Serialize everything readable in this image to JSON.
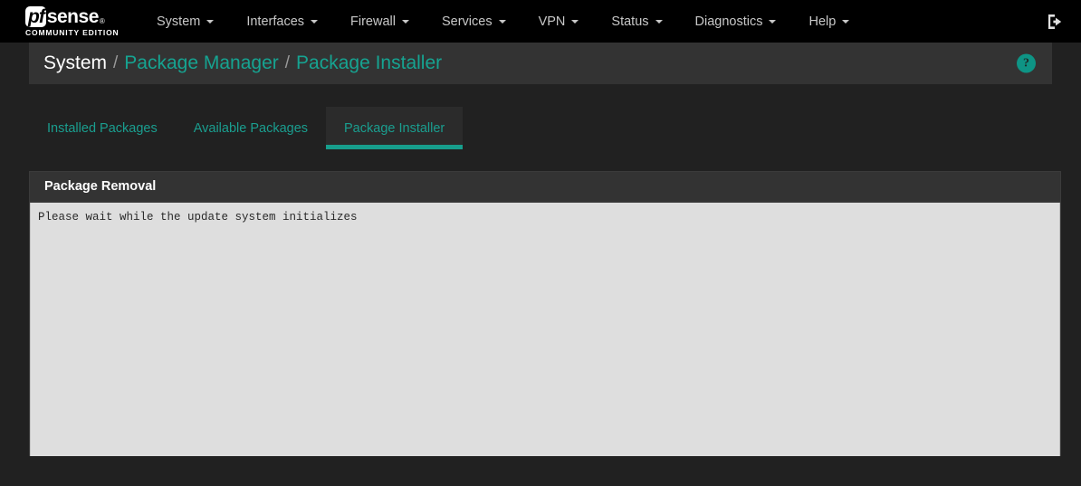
{
  "navbar": {
    "brand": {
      "pf": "pf",
      "sense": "sense",
      "registered": "®",
      "subtitle": "COMMUNITY EDITION"
    },
    "items": [
      {
        "label": "System",
        "icon": "chevron-down-icon"
      },
      {
        "label": "Interfaces",
        "icon": "chevron-down-icon"
      },
      {
        "label": "Firewall",
        "icon": "chevron-down-icon"
      },
      {
        "label": "Services",
        "icon": "chevron-down-icon"
      },
      {
        "label": "VPN",
        "icon": "chevron-down-icon"
      },
      {
        "label": "Status",
        "icon": "chevron-down-icon"
      },
      {
        "label": "Diagnostics",
        "icon": "chevron-down-icon"
      },
      {
        "label": "Help",
        "icon": "chevron-down-icon"
      }
    ],
    "logout_icon": "logout-icon"
  },
  "breadcrumb": {
    "root": "System",
    "separator": "/",
    "level2": "Package Manager",
    "level3": "Package Installer",
    "help_icon": "?"
  },
  "tabs": [
    {
      "label": "Installed Packages",
      "active": false
    },
    {
      "label": "Available Packages",
      "active": false
    },
    {
      "label": "Package Installer",
      "active": true
    }
  ],
  "panel": {
    "title": "Package Removal",
    "console_output": "Please wait while the update system initializes"
  },
  "colors": {
    "navbar_bg": "#000000",
    "body_bg": "#212121",
    "breadcrumb_bg": "#333333",
    "accent_teal": "#16a391",
    "active_tab_bg": "#2b2b2b",
    "panel_head_bg": "#333333",
    "console_bg": "#dedede"
  }
}
